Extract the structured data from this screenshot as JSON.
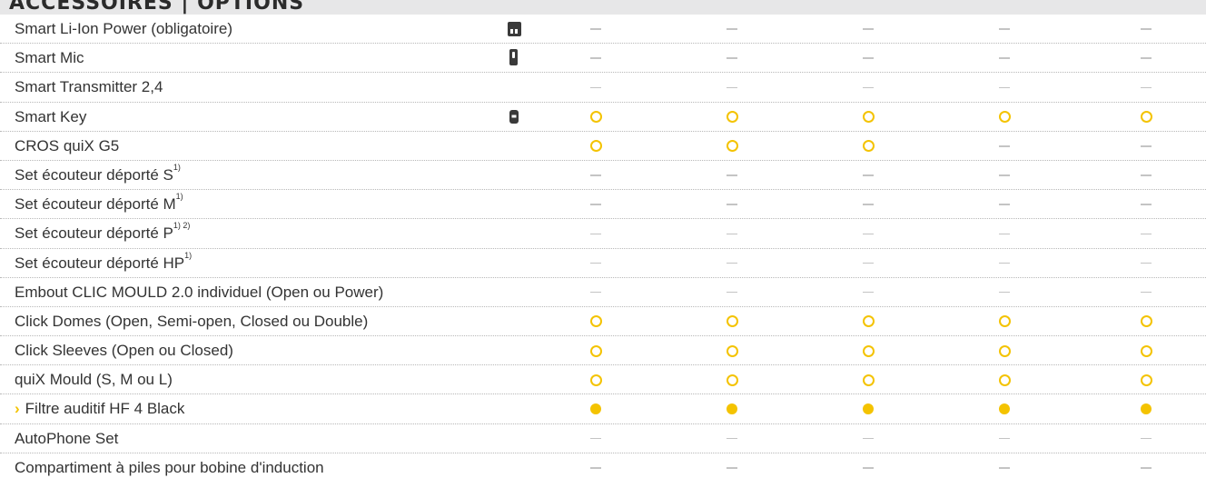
{
  "header": {
    "title": "ACCESSOIRES | OPTIONS"
  },
  "colors": {
    "option": "#f4c300",
    "standard": "#f4c300",
    "na": "#c4c4c4"
  },
  "legend_symbols": {
    "-": "not-available",
    "o": "optional",
    "*": "standard"
  },
  "rows": [
    {
      "label": "Smart Li-Ion Power (obligatoire)",
      "sup": "",
      "arrow": "",
      "icon": "battery-charger-icon",
      "values": [
        "-",
        "-",
        "-",
        "-",
        "-"
      ]
    },
    {
      "label": "Smart Mic",
      "sup": "",
      "arrow": "",
      "icon": "smart-mic-icon",
      "values": [
        "-",
        "-",
        "-",
        "-",
        "-"
      ]
    },
    {
      "label": "Smart Transmitter 2,4",
      "sup": "",
      "arrow": "",
      "icon": "",
      "values": [
        "-",
        "-",
        "-",
        "-",
        "-"
      ]
    },
    {
      "label": "Smart Key",
      "sup": "",
      "arrow": "",
      "icon": "smart-key-icon",
      "values": [
        "o",
        "o",
        "o",
        "o",
        "o"
      ]
    },
    {
      "label": "CROS quiX G5",
      "sup": "",
      "arrow": "",
      "icon": "",
      "values": [
        "o",
        "o",
        "o",
        "-",
        "-"
      ]
    },
    {
      "label": "Set écouteur déporté S",
      "sup": "1)",
      "arrow": "",
      "icon": "",
      "values": [
        "-",
        "-",
        "-",
        "-",
        "-"
      ]
    },
    {
      "label": "Set écouteur déporté M",
      "sup": "1)",
      "arrow": "",
      "icon": "",
      "values": [
        "-",
        "-",
        "-",
        "-",
        "-"
      ]
    },
    {
      "label": "Set écouteur déporté P",
      "sup": "1) 2)",
      "arrow": "",
      "icon": "",
      "values": [
        "-",
        "-",
        "-",
        "-",
        "-"
      ]
    },
    {
      "label": "Set écouteur déporté HP",
      "sup": "1)",
      "arrow": "",
      "icon": "",
      "values": [
        "-",
        "-",
        "-",
        "-",
        "-"
      ]
    },
    {
      "label": "Embout CLIC MOULD 2.0 individuel (Open ou Power)",
      "sup": "",
      "arrow": "",
      "icon": "",
      "values": [
        "-",
        "-",
        "-",
        "-",
        "-"
      ]
    },
    {
      "label": "Click Domes (Open, Semi-open, Closed ou Double)",
      "sup": "",
      "arrow": "",
      "icon": "",
      "values": [
        "o",
        "o",
        "o",
        "o",
        "o"
      ]
    },
    {
      "label": "Click Sleeves (Open ou Closed)",
      "sup": "",
      "arrow": "",
      "icon": "",
      "values": [
        "o",
        "o",
        "o",
        "o",
        "o"
      ]
    },
    {
      "label": "quiX Mould (S, M ou L)",
      "sup": "",
      "arrow": "",
      "icon": "",
      "values": [
        "o",
        "o",
        "o",
        "o",
        "o"
      ]
    },
    {
      "label": "Filtre auditif HF 4 Black",
      "sup": "",
      "arrow": "›",
      "icon": "",
      "values": [
        "*",
        "*",
        "*",
        "*",
        "*"
      ]
    },
    {
      "label": "AutoPhone Set",
      "sup": "",
      "arrow": "",
      "icon": "",
      "values": [
        "-",
        "-",
        "-",
        "-",
        "-"
      ]
    },
    {
      "label": "Compartiment à piles pour bobine d'induction",
      "sup": "",
      "arrow": "",
      "icon": "",
      "values": [
        "-",
        "-",
        "-",
        "-",
        "-"
      ]
    }
  ]
}
